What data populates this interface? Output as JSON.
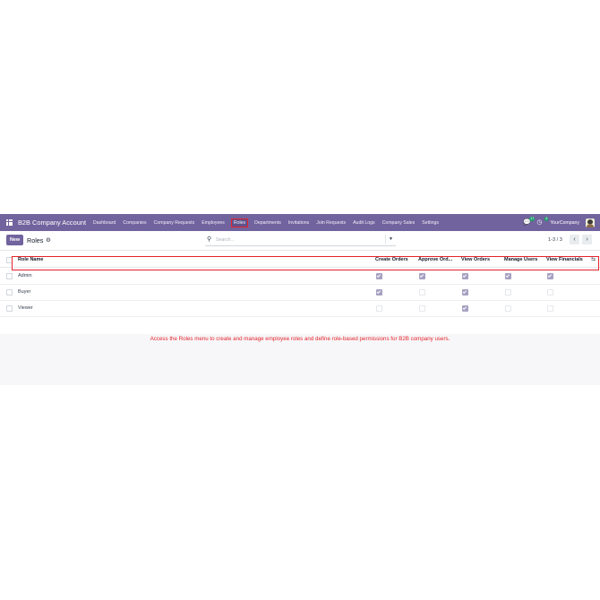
{
  "navbar": {
    "brand": "B2B Company Account",
    "menu": [
      "Dashboard",
      "Companies",
      "Company Requests",
      "Employees",
      "Roles",
      "Departments",
      "Invitations",
      "Join Requests",
      "Audit Logs",
      "Company Sales",
      "Settings"
    ],
    "active_menu": "Roles",
    "messages_badge": "17",
    "activities_badge": "4",
    "company": "YourCompany"
  },
  "control": {
    "new_label": "New",
    "breadcrumb": "Roles",
    "search_placeholder": "Search...",
    "pager": "1-3 / 3"
  },
  "table": {
    "columns": [
      "Role Name",
      "Create Orders",
      "Approve Ord...",
      "View Orders",
      "Manage Users",
      "View Financials"
    ],
    "rows": [
      {
        "name": "Admin",
        "perms": [
          true,
          true,
          true,
          true,
          true
        ]
      },
      {
        "name": "Buyer",
        "perms": [
          true,
          false,
          true,
          false,
          false
        ]
      },
      {
        "name": "Viewer",
        "perms": [
          false,
          false,
          true,
          false,
          false
        ]
      }
    ]
  },
  "note": "Access the Roles menu to create and manage employee roles and define role-based permissions for B2B company users.",
  "colors": {
    "brand": "#71639e",
    "highlight": "#e4232b",
    "checked": "#a7a1c2"
  },
  "icons": [
    "apps-grid-icon",
    "chat-icon",
    "activity-clock-icon",
    "gear-icon",
    "search-icon",
    "caret-down-icon",
    "chevron-left-icon",
    "chevron-right-icon",
    "optional-columns-icon"
  ]
}
